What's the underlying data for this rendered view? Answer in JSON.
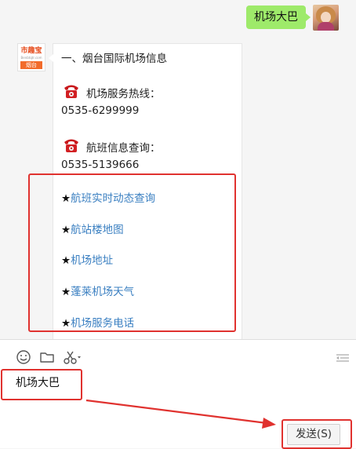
{
  "messages": {
    "outgoing_text": "机场大巴"
  },
  "bot_avatar": {
    "brand": "市趣宝",
    "domain": "Benbtqtr.com",
    "city_tag": "烟台"
  },
  "card": {
    "heading": "一、烟台国际机场信息",
    "hotline_label": "机场服务热线：",
    "hotline_number": "0535-6299999",
    "flight_label": "航班信息查询：",
    "flight_number": "0535-5139666",
    "star": "★",
    "links": [
      {
        "label": "航班实时动态查询"
      },
      {
        "label": "航站楼地图"
      },
      {
        "label": "机场地址"
      },
      {
        "label": "蓬莱机场天气"
      },
      {
        "label": "机场服务电话"
      }
    ]
  },
  "composer": {
    "input_value": "机场大巴",
    "send_label": "发送(S)",
    "tools": [
      "emoji-icon",
      "folder-icon",
      "scissors-icon",
      "expand-icon"
    ]
  },
  "colors": {
    "outgoing_bubble": "#9eea6a",
    "link": "#3a7fc1",
    "annotation_red": "#e0322f"
  }
}
